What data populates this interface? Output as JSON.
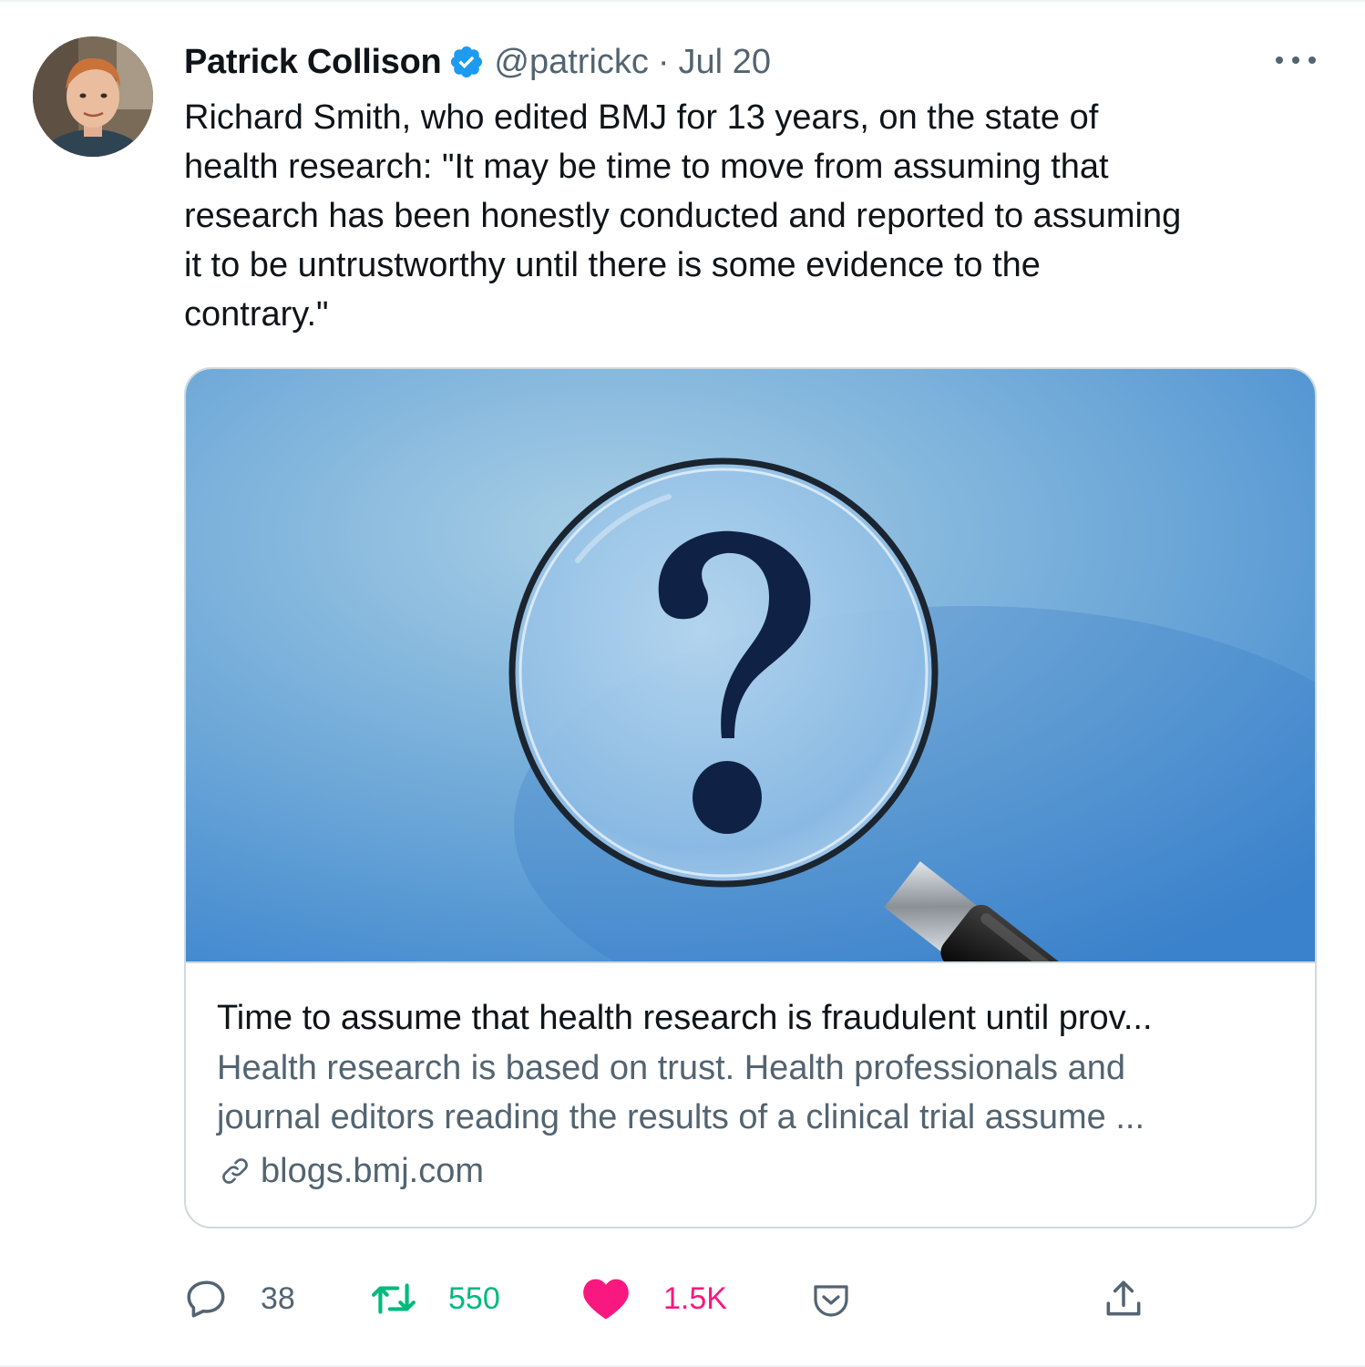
{
  "tweet": {
    "author_name": "Patrick Collison",
    "handle": "@patrickc",
    "separator": "·",
    "date": "Jul 20",
    "text": "Richard Smith, who edited BMJ for 13 years, on the state of\nhealth research: \"It may be time to move from assuming that\nresearch has been honestly conducted and reported to assuming\nit to be untrustworthy until there is some evidence to the\ncontrary.\""
  },
  "card": {
    "image_subject": "magnifying-glass-question-mark",
    "title": "Time to assume that health research is fraudulent until prov...",
    "description": "Health research is based on trust. Health professionals and\njournal editors reading the results of a clinical trial assume ...",
    "domain": "blogs.bmj.com"
  },
  "actions": {
    "replies": "38",
    "retweets": "550",
    "likes": "1.5K"
  },
  "icons": {
    "verified": "verified-badge-icon",
    "more": "more-icon",
    "reply": "reply-icon",
    "retweet": "retweet-icon",
    "like": "heart-icon",
    "tip": "tip-jar-icon",
    "share": "share-icon",
    "link": "link-icon"
  },
  "colors": {
    "verified_blue": "#1d9bf0",
    "retweet_green": "#00ba7c",
    "like_pink": "#f91880",
    "secondary_text": "#536471",
    "border": "#cfd9de"
  }
}
